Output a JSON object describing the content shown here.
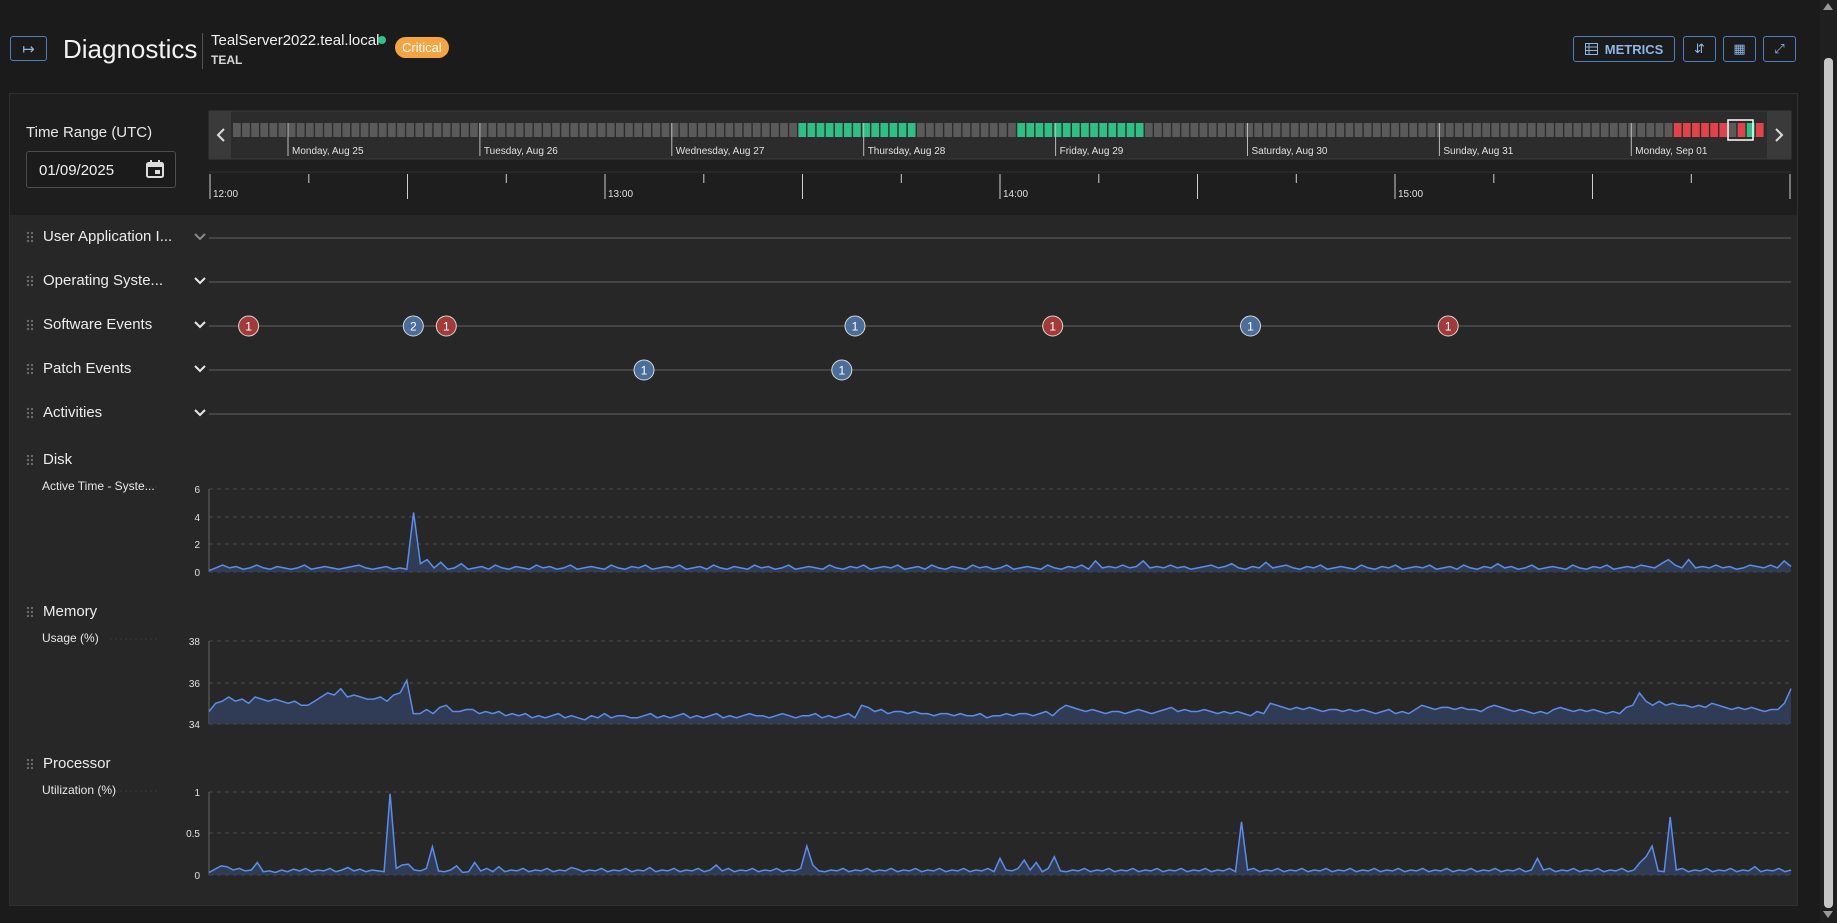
{
  "header": {
    "title": "Diagnostics",
    "server_name": "TealServer2022.teal.local",
    "tenant": "TEAL",
    "status_badge": "Critical",
    "metrics_label": "METRICS",
    "icons": [
      "sidebar-toggle-icon",
      "table-icon",
      "collapse-rows-icon",
      "grid-icon",
      "shrink-icon"
    ],
    "status_dot_color": "#2fc28d",
    "badge_color": "#f5a442"
  },
  "time_range": {
    "label": "Time Range (UTC)",
    "date_value": "01/09/2025",
    "day_labels": [
      "Monday, Aug 25",
      "Tuesday, Aug 26",
      "Wednesday, Aug 27",
      "Thursday, Aug 28",
      "Friday, Aug 29",
      "Saturday, Aug 30",
      "Sunday, Aug 31",
      "Monday, Sep 01"
    ],
    "hour_labels": [
      "12:00",
      "13:00",
      "14:00",
      "15:00"
    ],
    "colors": {
      "normal": "#5a5a5a",
      "healthy": "#2fbf86",
      "critical": "#e0434a"
    }
  },
  "event_rows": [
    {
      "label": "User Application I...",
      "markers": []
    },
    {
      "label": "Operating Syste...",
      "markers": []
    },
    {
      "label": "Software Events",
      "markers": [
        {
          "time": "12:06",
          "count": "1",
          "severity": "error"
        },
        {
          "time": "12:31",
          "count": "2",
          "severity": "info"
        },
        {
          "time": "12:36",
          "count": "1",
          "severity": "error"
        },
        {
          "time": "13:38",
          "count": "1",
          "severity": "info"
        },
        {
          "time": "14:08",
          "count": "1",
          "severity": "error"
        },
        {
          "time": "14:38",
          "count": "1",
          "severity": "info"
        },
        {
          "time": "15:08",
          "count": "1",
          "severity": "error"
        }
      ]
    },
    {
      "label": "Patch Events",
      "markers": [
        {
          "time": "13:06",
          "count": "1",
          "severity": "info"
        },
        {
          "time": "13:36",
          "count": "1",
          "severity": "info"
        }
      ]
    },
    {
      "label": "Activities",
      "markers": []
    }
  ],
  "chart_data": [
    {
      "type": "area",
      "section": "Disk",
      "series_label": "Active Time - Syste...",
      "yticks": [
        "6",
        "4",
        "2",
        "0"
      ],
      "ylim": [
        0,
        6
      ],
      "x_range": [
        "12:00",
        "16:00"
      ],
      "values": [
        0.1,
        0.3,
        0.5,
        0.3,
        0.4,
        0.2,
        0.3,
        0.5,
        0.3,
        0.2,
        0.4,
        0.3,
        0.2,
        0.3,
        0.5,
        0.2,
        0.3,
        0.4,
        0.3,
        0.2,
        0.3,
        0.4,
        0.5,
        0.3,
        0.2,
        0.3,
        0.4,
        0.2,
        0.3,
        0.2,
        4.3,
        0.6,
        0.9,
        0.3,
        0.7,
        0.2,
        0.3,
        0.6,
        0.2,
        0.3,
        0.4,
        0.2,
        0.5,
        0.3,
        0.2,
        0.4,
        0.3,
        0.2,
        0.5,
        0.3,
        0.4,
        0.2,
        0.3,
        0.5,
        0.2,
        0.3,
        0.4,
        0.3,
        0.2,
        0.5,
        0.3,
        0.2,
        0.4,
        0.3,
        0.5,
        0.2,
        0.3,
        0.4,
        0.3,
        0.5,
        0.2,
        0.3,
        0.4,
        0.2,
        0.5,
        0.3,
        0.2,
        0.4,
        0.3,
        0.2,
        0.5,
        0.3,
        0.4,
        0.2,
        0.3,
        0.5,
        0.2,
        0.3,
        0.4,
        0.3,
        0.2,
        0.5,
        0.3,
        0.2,
        0.4,
        0.3,
        0.5,
        0.2,
        0.3,
        0.4,
        0.3,
        0.5,
        0.2,
        0.3,
        0.4,
        0.2,
        0.5,
        0.3,
        0.2,
        0.4,
        0.3,
        0.2,
        0.5,
        0.3,
        0.4,
        0.2,
        0.3,
        0.5,
        0.2,
        0.3,
        0.4,
        0.3,
        0.2,
        0.5,
        0.3,
        0.2,
        0.4,
        0.3,
        0.5,
        0.2,
        0.8,
        0.3,
        0.4,
        0.3,
        0.5,
        0.3,
        0.4,
        0.8,
        0.3,
        0.4,
        0.3,
        0.5,
        0.3,
        0.4,
        0.2,
        0.3,
        0.4,
        0.5,
        0.3,
        0.4,
        0.6,
        0.3,
        0.2,
        0.4,
        0.3,
        0.7,
        0.3,
        0.4,
        0.5,
        0.3,
        0.2,
        0.4,
        0.3,
        0.5,
        0.2,
        0.3,
        0.4,
        0.3,
        0.2,
        0.5,
        0.3,
        0.2,
        0.4,
        0.3,
        0.5,
        0.2,
        0.3,
        0.4,
        0.3,
        0.5,
        0.2,
        0.3,
        0.4,
        0.2,
        0.5,
        0.3,
        0.2,
        0.4,
        0.3,
        0.6,
        0.3,
        0.4,
        0.2,
        0.3,
        0.5,
        0.2,
        0.3,
        0.4,
        0.3,
        0.2,
        0.5,
        0.3,
        0.2,
        0.4,
        0.3,
        0.5,
        0.2,
        0.3,
        0.4,
        0.3,
        0.5,
        0.4,
        0.3,
        0.6,
        0.9,
        0.5,
        0.3,
        0.9,
        0.3,
        0.4,
        0.3,
        0.5,
        0.3,
        0.4,
        0.2,
        0.3,
        0.5,
        0.4,
        0.3,
        0.5,
        0.3,
        0.8,
        0.4
      ]
    },
    {
      "type": "area",
      "section": "Memory",
      "series_label": "Usage (%)",
      "yticks": [
        "38",
        "36",
        "34"
      ],
      "ylim": [
        34,
        38
      ],
      "x_range": [
        "12:00",
        "16:00"
      ],
      "values": [
        34.6,
        35.0,
        35.1,
        35.3,
        35.1,
        35.2,
        35.0,
        35.3,
        35.2,
        35.1,
        35.2,
        35.1,
        35.0,
        35.1,
        34.9,
        34.9,
        35.1,
        35.3,
        35.5,
        35.4,
        35.7,
        35.3,
        35.4,
        35.3,
        35.2,
        35.2,
        35.3,
        35.1,
        35.4,
        35.5,
        36.1,
        34.5,
        34.5,
        34.7,
        34.5,
        34.8,
        34.9,
        34.6,
        34.6,
        34.7,
        34.7,
        34.5,
        34.6,
        34.5,
        34.6,
        34.4,
        34.5,
        34.4,
        34.5,
        34.3,
        34.4,
        34.3,
        34.4,
        34.5,
        34.3,
        34.4,
        34.3,
        34.2,
        34.4,
        34.3,
        34.5,
        34.3,
        34.4,
        34.4,
        34.3,
        34.3,
        34.4,
        34.5,
        34.3,
        34.4,
        34.3,
        34.4,
        34.5,
        34.3,
        34.4,
        34.3,
        34.4,
        34.5,
        34.3,
        34.4,
        34.3,
        34.4,
        34.5,
        34.4,
        34.4,
        34.3,
        34.4,
        34.5,
        34.4,
        34.3,
        34.4,
        34.4,
        34.5,
        34.3,
        34.4,
        34.3,
        34.4,
        34.5,
        34.3,
        34.9,
        34.8,
        34.6,
        34.7,
        34.5,
        34.6,
        34.6,
        34.5,
        34.6,
        34.5,
        34.5,
        34.4,
        34.5,
        34.5,
        34.4,
        34.5,
        34.4,
        34.4,
        34.5,
        34.3,
        34.4,
        34.4,
        34.5,
        34.4,
        34.5,
        34.5,
        34.4,
        34.5,
        34.6,
        34.4,
        34.7,
        34.9,
        34.8,
        34.7,
        34.6,
        34.7,
        34.6,
        34.5,
        34.6,
        34.6,
        34.5,
        34.6,
        34.7,
        34.6,
        34.5,
        34.6,
        34.7,
        34.8,
        34.6,
        34.7,
        34.6,
        34.6,
        34.7,
        34.6,
        34.5,
        34.6,
        34.5,
        34.6,
        34.5,
        34.4,
        34.6,
        34.5,
        35.0,
        34.9,
        34.8,
        34.7,
        34.8,
        34.7,
        34.8,
        34.7,
        34.6,
        34.7,
        34.7,
        34.6,
        34.7,
        34.6,
        34.7,
        34.6,
        34.5,
        34.6,
        34.7,
        34.5,
        34.6,
        34.5,
        34.7,
        34.9,
        34.8,
        34.7,
        34.8,
        34.8,
        34.7,
        34.8,
        34.7,
        34.7,
        34.6,
        34.8,
        34.9,
        34.8,
        34.7,
        34.6,
        34.7,
        34.6,
        34.5,
        34.6,
        34.5,
        34.7,
        34.8,
        34.7,
        34.6,
        34.7,
        34.6,
        34.7,
        34.6,
        34.5,
        34.6,
        34.5,
        34.8,
        34.9,
        35.5,
        35.1,
        34.9,
        35.1,
        34.9,
        35.0,
        34.9,
        34.9,
        34.8,
        34.9,
        34.8,
        35.0,
        34.9,
        34.8,
        34.7,
        34.8,
        34.7,
        34.8,
        34.7,
        34.6,
        34.7,
        34.7,
        35.0,
        35.7
      ]
    },
    {
      "type": "area",
      "section": "Processor",
      "series_label": "Utilization (%)",
      "yticks": [
        "1",
        "0.5",
        "0"
      ],
      "ylim": [
        0,
        1
      ],
      "x_range": [
        "12:00",
        "16:00"
      ],
      "values": [
        0.03,
        0.07,
        0.11,
        0.1,
        0.06,
        0.08,
        0.05,
        0.06,
        0.15,
        0.04,
        0.05,
        0.03,
        0.06,
        0.04,
        0.07,
        0.05,
        0.08,
        0.04,
        0.06,
        0.05,
        0.08,
        0.04,
        0.06,
        0.09,
        0.05,
        0.07,
        0.04,
        0.06,
        0.05,
        0.04,
        0.98,
        0.08,
        0.12,
        0.13,
        0.06,
        0.05,
        0.08,
        0.34,
        0.05,
        0.04,
        0.06,
        0.11,
        0.03,
        0.04,
        0.15,
        0.05,
        0.08,
        0.04,
        0.1,
        0.04,
        0.06,
        0.05,
        0.08,
        0.04,
        0.06,
        0.05,
        0.08,
        0.04,
        0.06,
        0.05,
        0.09,
        0.07,
        0.04,
        0.06,
        0.05,
        0.08,
        0.04,
        0.06,
        0.05,
        0.08,
        0.04,
        0.06,
        0.05,
        0.09,
        0.04,
        0.06,
        0.05,
        0.08,
        0.04,
        0.06,
        0.05,
        0.08,
        0.04,
        0.06,
        0.12,
        0.05,
        0.08,
        0.04,
        0.06,
        0.05,
        0.08,
        0.04,
        0.06,
        0.05,
        0.08,
        0.04,
        0.06,
        0.05,
        0.08,
        0.35,
        0.12,
        0.05,
        0.04,
        0.06,
        0.05,
        0.08,
        0.04,
        0.06,
        0.05,
        0.08,
        0.04,
        0.06,
        0.05,
        0.08,
        0.04,
        0.06,
        0.05,
        0.08,
        0.04,
        0.06,
        0.05,
        0.08,
        0.04,
        0.06,
        0.05,
        0.08,
        0.04,
        0.06,
        0.05,
        0.08,
        0.04,
        0.2,
        0.06,
        0.05,
        0.08,
        0.18,
        0.06,
        0.15,
        0.04,
        0.08,
        0.22,
        0.05,
        0.04,
        0.06,
        0.05,
        0.08,
        0.04,
        0.06,
        0.05,
        0.08,
        0.04,
        0.06,
        0.05,
        0.08,
        0.04,
        0.06,
        0.05,
        0.08,
        0.04,
        0.06,
        0.05,
        0.08,
        0.04,
        0.06,
        0.05,
        0.08,
        0.04,
        0.06,
        0.05,
        0.08,
        0.04,
        0.64,
        0.06,
        0.08,
        0.04,
        0.06,
        0.05,
        0.08,
        0.04,
        0.06,
        0.05,
        0.08,
        0.04,
        0.06,
        0.05,
        0.08,
        0.04,
        0.06,
        0.05,
        0.08,
        0.04,
        0.06,
        0.05,
        0.08,
        0.04,
        0.06,
        0.05,
        0.08,
        0.04,
        0.06,
        0.05,
        0.08,
        0.04,
        0.06,
        0.05,
        0.08,
        0.04,
        0.06,
        0.05,
        0.08,
        0.04,
        0.06,
        0.05,
        0.08,
        0.04,
        0.06,
        0.05,
        0.08,
        0.04,
        0.06,
        0.2,
        0.06,
        0.08,
        0.04,
        0.06,
        0.05,
        0.08,
        0.04,
        0.06,
        0.05,
        0.08,
        0.04,
        0.06,
        0.05,
        0.08,
        0.04,
        0.06,
        0.15,
        0.22,
        0.35,
        0.05,
        0.04,
        0.7,
        0.06,
        0.08,
        0.04,
        0.06,
        0.05,
        0.08,
        0.04,
        0.06,
        0.05,
        0.08,
        0.04,
        0.06,
        0.05,
        0.1,
        0.04,
        0.06,
        0.05,
        0.08,
        0.04,
        0.06
      ]
    }
  ]
}
